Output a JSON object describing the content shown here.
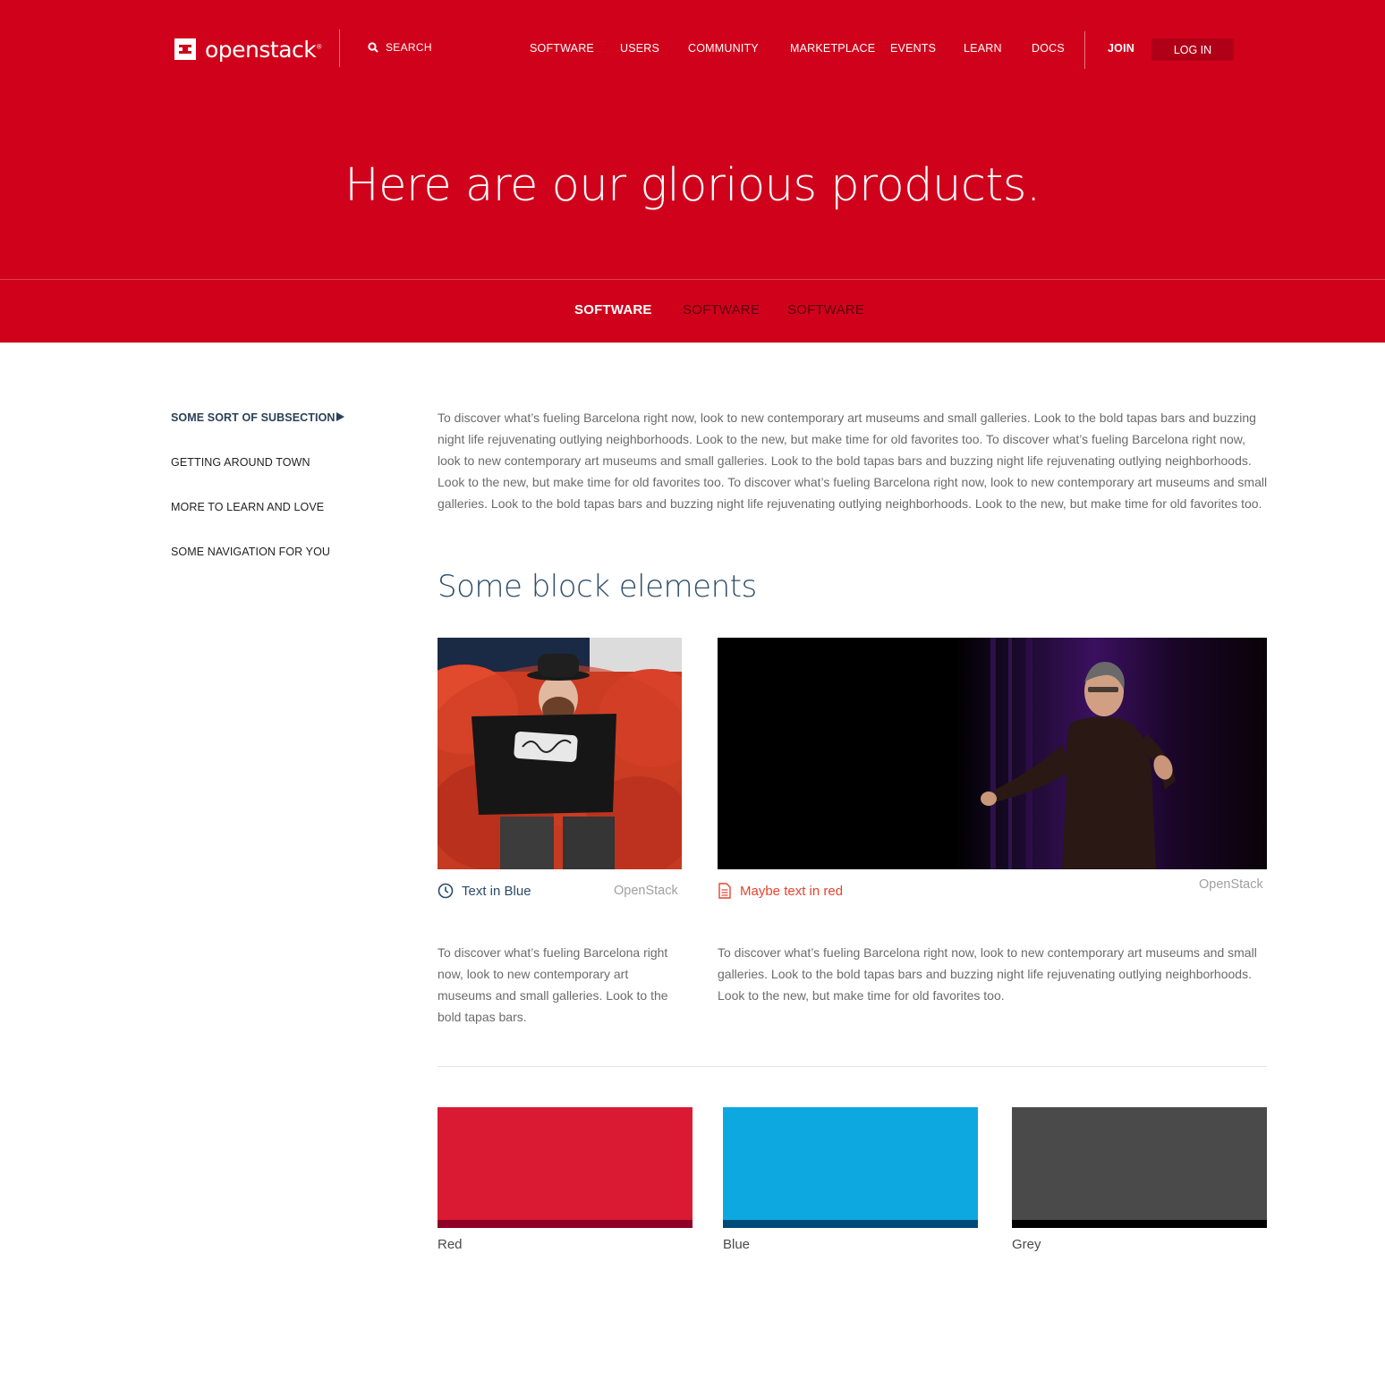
{
  "header": {
    "logo_text": "openstack",
    "logo_mark": "®",
    "search_label": "SEARCH",
    "nav": [
      "SOFTWARE",
      "USERS",
      "COMMUNITY",
      "MARKETPLACE",
      "EVENTS",
      "LEARN",
      "DOCS"
    ],
    "join_label": "JOIN",
    "login_label": "LOG IN"
  },
  "hero": {
    "title": "Here are our glorious products.",
    "subnav": [
      "SOFTWARE",
      "SOFTWARE",
      "SOFTWARE"
    ],
    "active_subnav": 0
  },
  "sidebar": {
    "items": [
      "SOME SORT OF SUBSECTION",
      "GETTING AROUND TOWN",
      "MORE TO LEARN AND LOVE",
      "SOME NAVIGATION FOR YOU"
    ],
    "active_index": 0
  },
  "main": {
    "intro": "To discover what’s fueling Barcelona right now, look to new contemporary art museums and small galleries. Look to the bold tapas bars and buzzing night life rejuvenating outlying neighborhoods. Look to the new, but make time for old favorites too. To discover what’s fueling Barcelona right now, look to new contemporary art museums and small galleries. Look to the bold tapas bars and buzzing night life rejuvenating outlying neighborhoods. Look to the new, but make time for old favorites too. To discover what’s fueling Barcelona right now, look to new contemporary art museums and small galleries. Look to the bold tapas bars and buzzing night life rejuvenating outlying neighborhoods. Look to the new, but make time for old favorites too.",
    "section_title": "Some block elements",
    "card_left": {
      "caption": "Text in Blue",
      "caption_icon": "clock-icon",
      "credit": "OpenStack",
      "blurb": "To discover what’s fueling Barcelona right now, look to new contemporary art museums and small galleries. Look to the bold tapas bars."
    },
    "card_right": {
      "caption": "Maybe text in red",
      "caption_icon": "document-icon",
      "credit": "OpenStack",
      "blurb": "To discover what’s fueling Barcelona right now, look to new contemporary art museums and small galleries. Look to the bold tapas bars and buzzing night life rejuvenating outlying neighborhoods. Look to the new, but make time for old favorites too."
    },
    "swatches": [
      {
        "label": "Red",
        "color": "#da1a32",
        "shade": "#8f0026"
      },
      {
        "label": "Blue",
        "color": "#0ea8e0",
        "shade": "#004a78"
      },
      {
        "label": "Grey",
        "color": "#4a4a4a",
        "shade": "#000000"
      }
    ]
  },
  "colors": {
    "brand_red": "#d0021b",
    "heading_blue": "#2f4f6b",
    "accent_red": "#e8432d"
  }
}
